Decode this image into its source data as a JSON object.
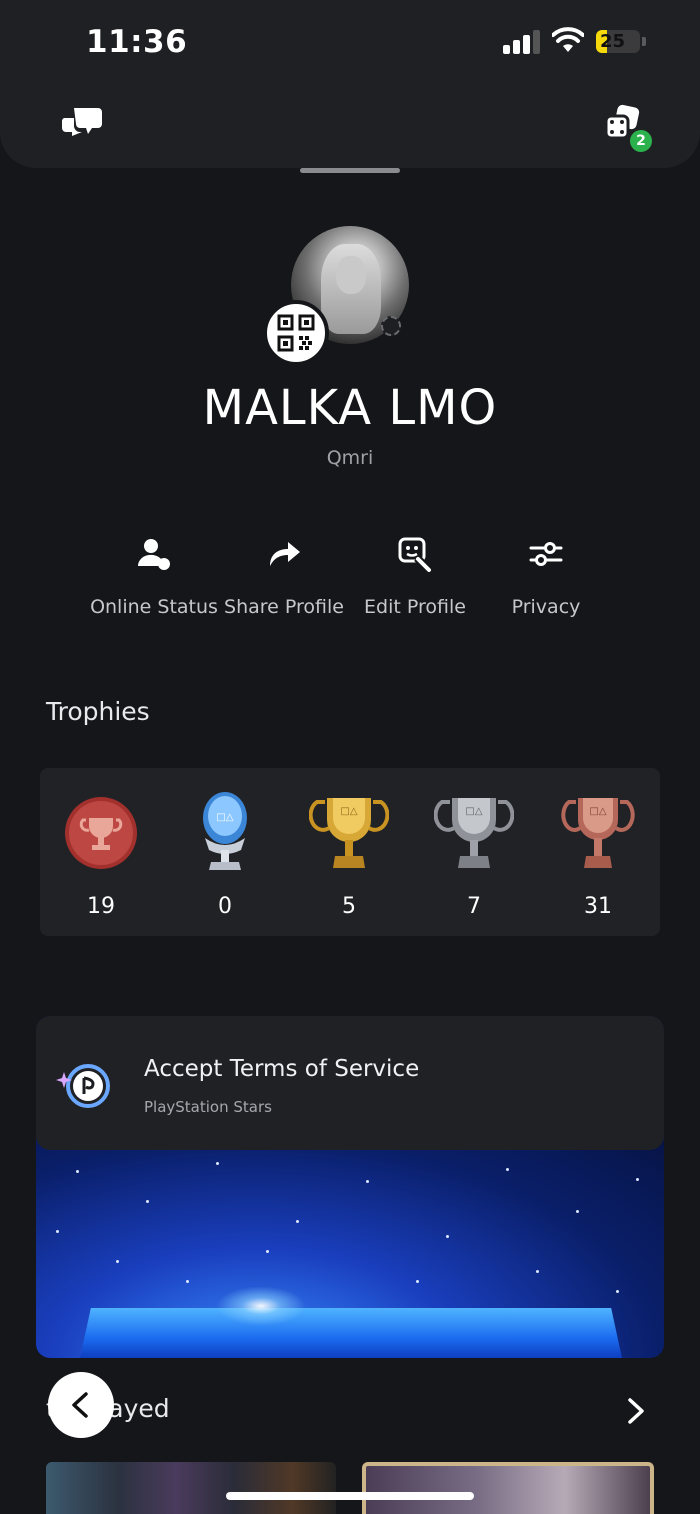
{
  "status_bar": {
    "time": "11:36",
    "battery_level": "25",
    "battery_fraction": 0.25,
    "battery_color": "#f5d90a"
  },
  "top_bar": {
    "left_icon": "chat-bubbles-icon",
    "right_icon": "game-lists-icon",
    "right_badge": "2",
    "badge_color": "#2bb24c"
  },
  "profile": {
    "name": "MALKA LMO",
    "online_id": "Qmri",
    "avatar": "profile-photo",
    "qr_icon": "qr-code-icon",
    "status_icon": "offline-status-icon"
  },
  "actions": [
    {
      "label": "Online Status",
      "icon": "person-status-icon"
    },
    {
      "label": "Share Profile",
      "icon": "share-arrow-icon"
    },
    {
      "label": "Edit Profile",
      "icon": "edit-profile-icon"
    },
    {
      "label": "Privacy",
      "icon": "sliders-icon"
    }
  ],
  "trophies": {
    "title": "Trophies",
    "items": [
      {
        "type": "level",
        "count": "19",
        "icon": "trophy-level-icon",
        "color": "#b03a36"
      },
      {
        "type": "platinum",
        "count": "0",
        "icon": "platinum-trophy-icon",
        "color": "#9fd2ff"
      },
      {
        "type": "gold",
        "count": "5",
        "icon": "gold-trophy-icon",
        "color": "#d8a836"
      },
      {
        "type": "silver",
        "count": "7",
        "icon": "silver-trophy-icon",
        "color": "#b9bcc2"
      },
      {
        "type": "bronze",
        "count": "31",
        "icon": "bronze-trophy-icon",
        "color": "#c87b68"
      }
    ]
  },
  "stars_card": {
    "title": "Accept Terms of Service",
    "subtitle": "PlayStation Stars",
    "icon": "playstation-stars-icon",
    "accent": "#1c6cf0"
  },
  "recently_played": {
    "label": "tly played",
    "chevron": "chevron-right-icon"
  },
  "back_button_icon": "chevron-left-icon"
}
